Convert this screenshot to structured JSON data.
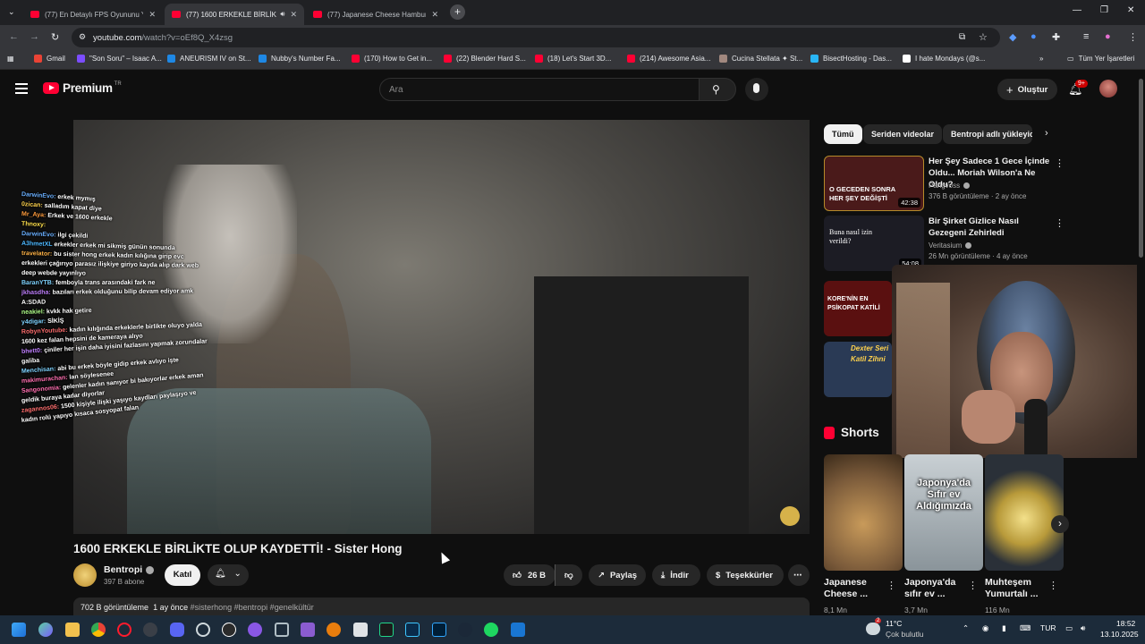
{
  "tabs": [
    {
      "title": "(77) En Detaylı FPS Oyununu Ya",
      "active": false
    },
    {
      "title": "(77) 1600 ERKEKLE BİRLİKTE",
      "active": true
    },
    {
      "title": "(77) Japanese Cheese Hamburg",
      "active": false
    }
  ],
  "tab_close": "✕",
  "new_tab": "+",
  "address": {
    "host": "youtube.com",
    "path": "/watch?v=oEf8Q_X4zsg"
  },
  "bookmarks": [
    {
      "label": "Gmail",
      "color": "#ea4335"
    },
    {
      "label": "\"Son Soru\" – Isaac A...",
      "color": "#7c4dff"
    },
    {
      "label": "ANEURISM IV on St...",
      "color": "#1e88e5"
    },
    {
      "label": "Nubby's Number Fa...",
      "color": "#1e88e5"
    },
    {
      "label": "(170) How to Get in...",
      "color": "#ff0033"
    },
    {
      "label": "(22) Blender Hard S...",
      "color": "#ff0033"
    },
    {
      "label": "(18) Let's Start 3D...",
      "color": "#ff0033"
    },
    {
      "label": "(214) Awesome Asia...",
      "color": "#ff0033"
    },
    {
      "label": "Cucina Stellata ✦ St...",
      "color": "#a1887f"
    },
    {
      "label": "BisectHosting - Das...",
      "color": "#29b6f6"
    },
    {
      "label": "I hate Mondays (@s...",
      "color": "#ffffff"
    }
  ],
  "all_bookmarks": "Tüm Yer İşaretleri",
  "header": {
    "logo_text": "Premium",
    "logo_region": "TR",
    "search_placeholder": "Ara",
    "create_label": "Oluştur",
    "notif_badge": "9+"
  },
  "chat": [
    {
      "user": "DarwinEvo:",
      "text": "erkek mymış",
      "color": "#6ab0ff"
    },
    {
      "user": "0zican:",
      "text": "salladım kapat diye",
      "color": "#ffd34d"
    },
    {
      "user": "Mr_Aya:",
      "text": "Erkek ve 1600 erkekle",
      "color": "#ff9c3d"
    },
    {
      "user": "Thnoxy:",
      "text": "",
      "color": "#ffe14d"
    },
    {
      "user": "DarwinEvo:",
      "text": "ilgi çekildi",
      "color": "#6ab0ff"
    },
    {
      "user": "A3hmetXL",
      "text": "erkekler erkek mi sikmiş günün sonunda",
      "color": "#4db8ff"
    },
    {
      "user": "travelator:",
      "text": "bu sister hong erkek kadın kılığına girip evc",
      "color": "#ffb347"
    },
    {
      "user": "",
      "text": "erkekleri çağırıyo parasız ilişkiye giriyo kayda alıp dark web",
      "color": "#ffffff"
    },
    {
      "user": "",
      "text": "deep webde yayınlıyo",
      "color": "#ffffff"
    },
    {
      "user": "BaranYTB:",
      "text": "femboyla trans arasındaki fark ne",
      "color": "#7fd3ff"
    },
    {
      "user": "jkhasdha:",
      "text": "bazıları erkek olduğunu bilip devam ediyor amk",
      "color": "#c080ff"
    },
    {
      "user": "",
      "text": "A:SDAD",
      "color": "#ffffff"
    },
    {
      "user": "neakiel:",
      "text": "kvkk hak getire",
      "color": "#b0ff8a"
    },
    {
      "user": "y4digar:",
      "text": "SİKİŞ",
      "color": "#7fd3ff"
    },
    {
      "user": "RobynYoutube:",
      "text": "kadın kılığında erkeklerle birlikte oluyo yalda",
      "color": "#ff6f6f"
    },
    {
      "user": "",
      "text": "1600 kez falan hepsini de kameraya alıyo",
      "color": "#ffffff"
    },
    {
      "user": "bhett0:",
      "text": "çiniler her işin daha iyisini fazlasını yapmak zorundalar",
      "color": "#c080ff"
    },
    {
      "user": "",
      "text": "galiba",
      "color": "#ffffff"
    },
    {
      "user": "Menchisan:",
      "text": "abi bu erkek böyle gidip erkek avlıyo işte",
      "color": "#7fd3ff"
    },
    {
      "user": "makimurachan:",
      "text": "lan söylesenee",
      "color": "#ff6fb0"
    },
    {
      "user": "Sangonomia:",
      "text": "gelenler kadın sanıyor bi bakıyorlar erkek aman",
      "color": "#ff6fb0"
    },
    {
      "user": "",
      "text": "geldik buraya kadar diyorlar",
      "color": "#ffffff"
    },
    {
      "user": "zagannos06:",
      "text": "1500 kişiyle ilişki yaşıyo kaydları paylaşıyo ve",
      "color": "#ff6f6f"
    },
    {
      "user": "",
      "text": "kadın rolü yapıyo kısaca sosyopat falan",
      "color": "#ffffff"
    }
  ],
  "video": {
    "title": "1600 ERKEKLE BİRLİKTE OLUP KAYDETTİ! - Sister Hong",
    "channel": "Bentropi",
    "subscribers": "397 B abone",
    "join_label": "Katıl",
    "likes": "26 B",
    "share_label": "Paylaş",
    "download_label": "İndir",
    "thanks_label": "Teşekkürler",
    "more_label": "⋯",
    "views": "702 B görüntüleme",
    "age": "1 ay önce",
    "tags": "#sisterhong #bentropi #genelkültür"
  },
  "chips": [
    "Tümü",
    "Seriden videolar",
    "Bentropi adlı yükleyic"
  ],
  "recommendations": [
    {
      "title": "Her Şey Sadece 1 Gece İçinde Oldu... Moriah Wilson'a Ne Oldu?",
      "channel": "Pangvoss",
      "meta": "376 B görüntüleme · 2 ay önce",
      "duration": "42:38",
      "thumb_text": "O GECEDEN SONRA HER ŞEY DEĞİŞTİ",
      "bg": "#4a1a1a"
    },
    {
      "title": "Bir Şirket Gizlice Nasıl Gezegeni Zehirledi",
      "channel": "Veritasium",
      "meta": "26 Mn görüntüleme · 4 ay önce",
      "duration": "54:08",
      "thumb_text": "Buna nasıl izin verildi?",
      "bg": "#1c1c24"
    },
    {
      "title": "",
      "channel": "",
      "meta": "",
      "duration": "",
      "thumb_text": "KORE'NİN EN PSİKOPAT KATİLİ",
      "bg": "#5a1010"
    },
    {
      "title": "",
      "channel": "",
      "meta": "",
      "duration": "",
      "thumb_text": "Dexter Seri Katil Zihni",
      "bg": "#2a3a55"
    }
  ],
  "shorts_title": "Shorts",
  "shorts": [
    {
      "title": "Japanese Cheese ...",
      "views": "8,1 Mn",
      "bg": "#7a5a3a",
      "overlay": ""
    },
    {
      "title": "Japonya'da sıfır ev ...",
      "views": "3,7 Mn",
      "bg": "#9aa3a8",
      "overlay": "Japonya'da Sıfır ev Aldığımızda"
    },
    {
      "title": "Muhteşem Yumurtalı ...",
      "views": "116 Mn",
      "bg": "#2a3038",
      "overlay": ""
    }
  ],
  "taskbar": {
    "weather_temp": "11°C",
    "weather_desc": "Çok bulutlu",
    "lang": "TUR",
    "time": "18:52",
    "date": "13.10.2025",
    "weather_badge": "2"
  }
}
